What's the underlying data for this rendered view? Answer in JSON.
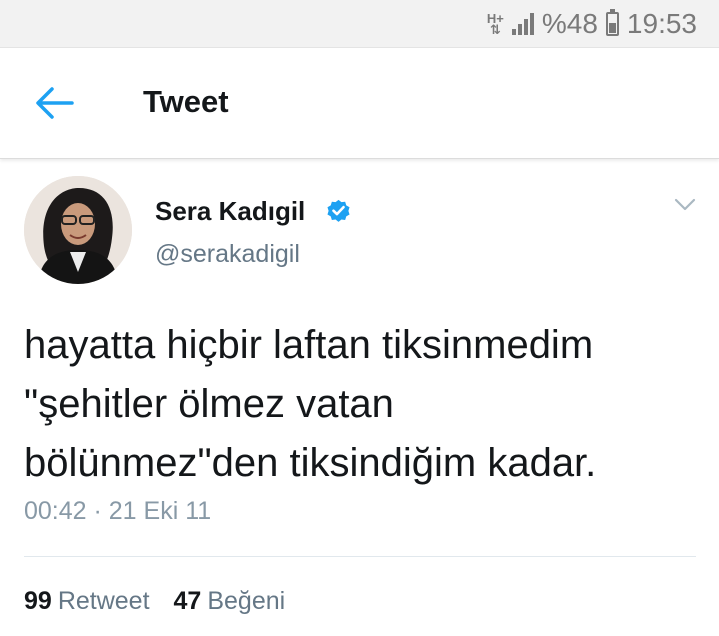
{
  "status_bar": {
    "network": "H+",
    "battery_percent": "%48",
    "battery_level": 0.48,
    "time": "19:53",
    "icons": [
      "network-type-icon",
      "signal-icon",
      "battery-icon"
    ]
  },
  "header": {
    "back_icon": "arrow-left-icon",
    "title": "Tweet"
  },
  "tweet": {
    "author_name": "Sera Kadıgil",
    "verified": true,
    "handle": "@serakadigil",
    "text_lines": [
      "hayatta hiçbir laftan tiksinmedim",
      "\"şehitler ölmez vatan",
      "bölünmez\"den tiksindiğim kadar."
    ],
    "timestamp": "00:42 · 21 Eki 11",
    "retweets": {
      "count": "99",
      "label": "Retweet"
    },
    "likes": {
      "count": "47",
      "label": "Beğeni"
    }
  },
  "colors": {
    "accent": "#1da1f2",
    "text": "#14171a",
    "secondary": "#657786",
    "status_bar": "#f2f2f2"
  }
}
